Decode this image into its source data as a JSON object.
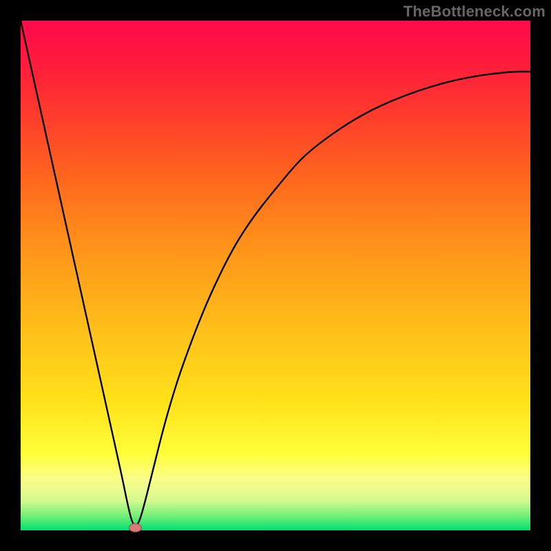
{
  "attribution": "TheBottleneck.com",
  "colors": {
    "frame": "#000000",
    "gradient_top": "#ff0a4d",
    "gradient_mid": "#ffd81a",
    "gradient_bottom": "#00e070",
    "curve": "#000000",
    "marker_fill": "#d97b7b",
    "marker_stroke": "#a04a4a"
  },
  "chart_data": {
    "type": "line",
    "title": "",
    "xlabel": "",
    "ylabel": "",
    "xlim": [
      0,
      100
    ],
    "ylim": [
      0,
      100
    ],
    "grid": false,
    "legend": false,
    "annotations": [],
    "series": [
      {
        "name": "bottleneck-curve",
        "x": [
          0,
          2,
          4,
          6,
          8,
          10,
          12,
          14,
          16,
          18,
          20,
          21,
          22,
          23,
          24,
          26,
          28,
          30,
          32,
          35,
          38,
          42,
          46,
          50,
          55,
          60,
          66,
          72,
          80,
          88,
          96,
          100
        ],
        "values": [
          100,
          91,
          82,
          73,
          64,
          55,
          46,
          37,
          28,
          19,
          10,
          5,
          1,
          1,
          4,
          12,
          20,
          27,
          33,
          41,
          48,
          56,
          62,
          67,
          73,
          77,
          81,
          84,
          87,
          89,
          90,
          90
        ]
      }
    ],
    "marker": {
      "x": 22.5,
      "y": 0.5,
      "label": ""
    }
  }
}
